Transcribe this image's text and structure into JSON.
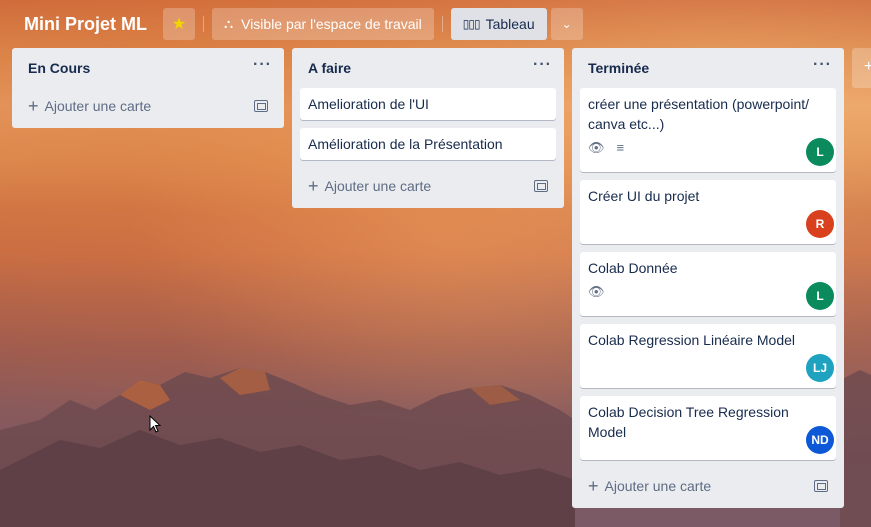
{
  "header": {
    "title": "Mini Projet ML",
    "visibility_label": "Visible par l'espace de travail",
    "board_view_label": "Tableau"
  },
  "lists": [
    {
      "title": "En Cours",
      "cards": [],
      "add_label": "Ajouter une carte"
    },
    {
      "title": "A faire",
      "cards": [
        {
          "title": "Amelioration de l'UI"
        },
        {
          "title": "Amélioration de la Présentation"
        }
      ],
      "add_label": "Ajouter une carte"
    },
    {
      "title": "Terminée",
      "cards": [
        {
          "title": "créer une présentation (powerpoint/ canva etc...)",
          "badges": [
            "eye-icon",
            "description-icon"
          ],
          "member": "L",
          "member_color": "#0b8a5c"
        },
        {
          "title": "Créer UI du projet",
          "member": "R",
          "member_color": "#d9411e"
        },
        {
          "title": "Colab Donnée",
          "badges": [
            "eye-icon"
          ],
          "member": "L",
          "member_color": "#0b8a5c"
        },
        {
          "title": "Colab Regression Linéaire Model",
          "member": "LJ",
          "member_color": "#1fa2c0"
        },
        {
          "title": "Colab Decision Tree Regression Model",
          "member": "ND",
          "member_color": "#0c58d6"
        }
      ],
      "add_label": "Ajouter une carte"
    }
  ],
  "colors": {
    "list_bg": "#ebecf0",
    "text": "#172b4d",
    "star": "#f2d600"
  }
}
